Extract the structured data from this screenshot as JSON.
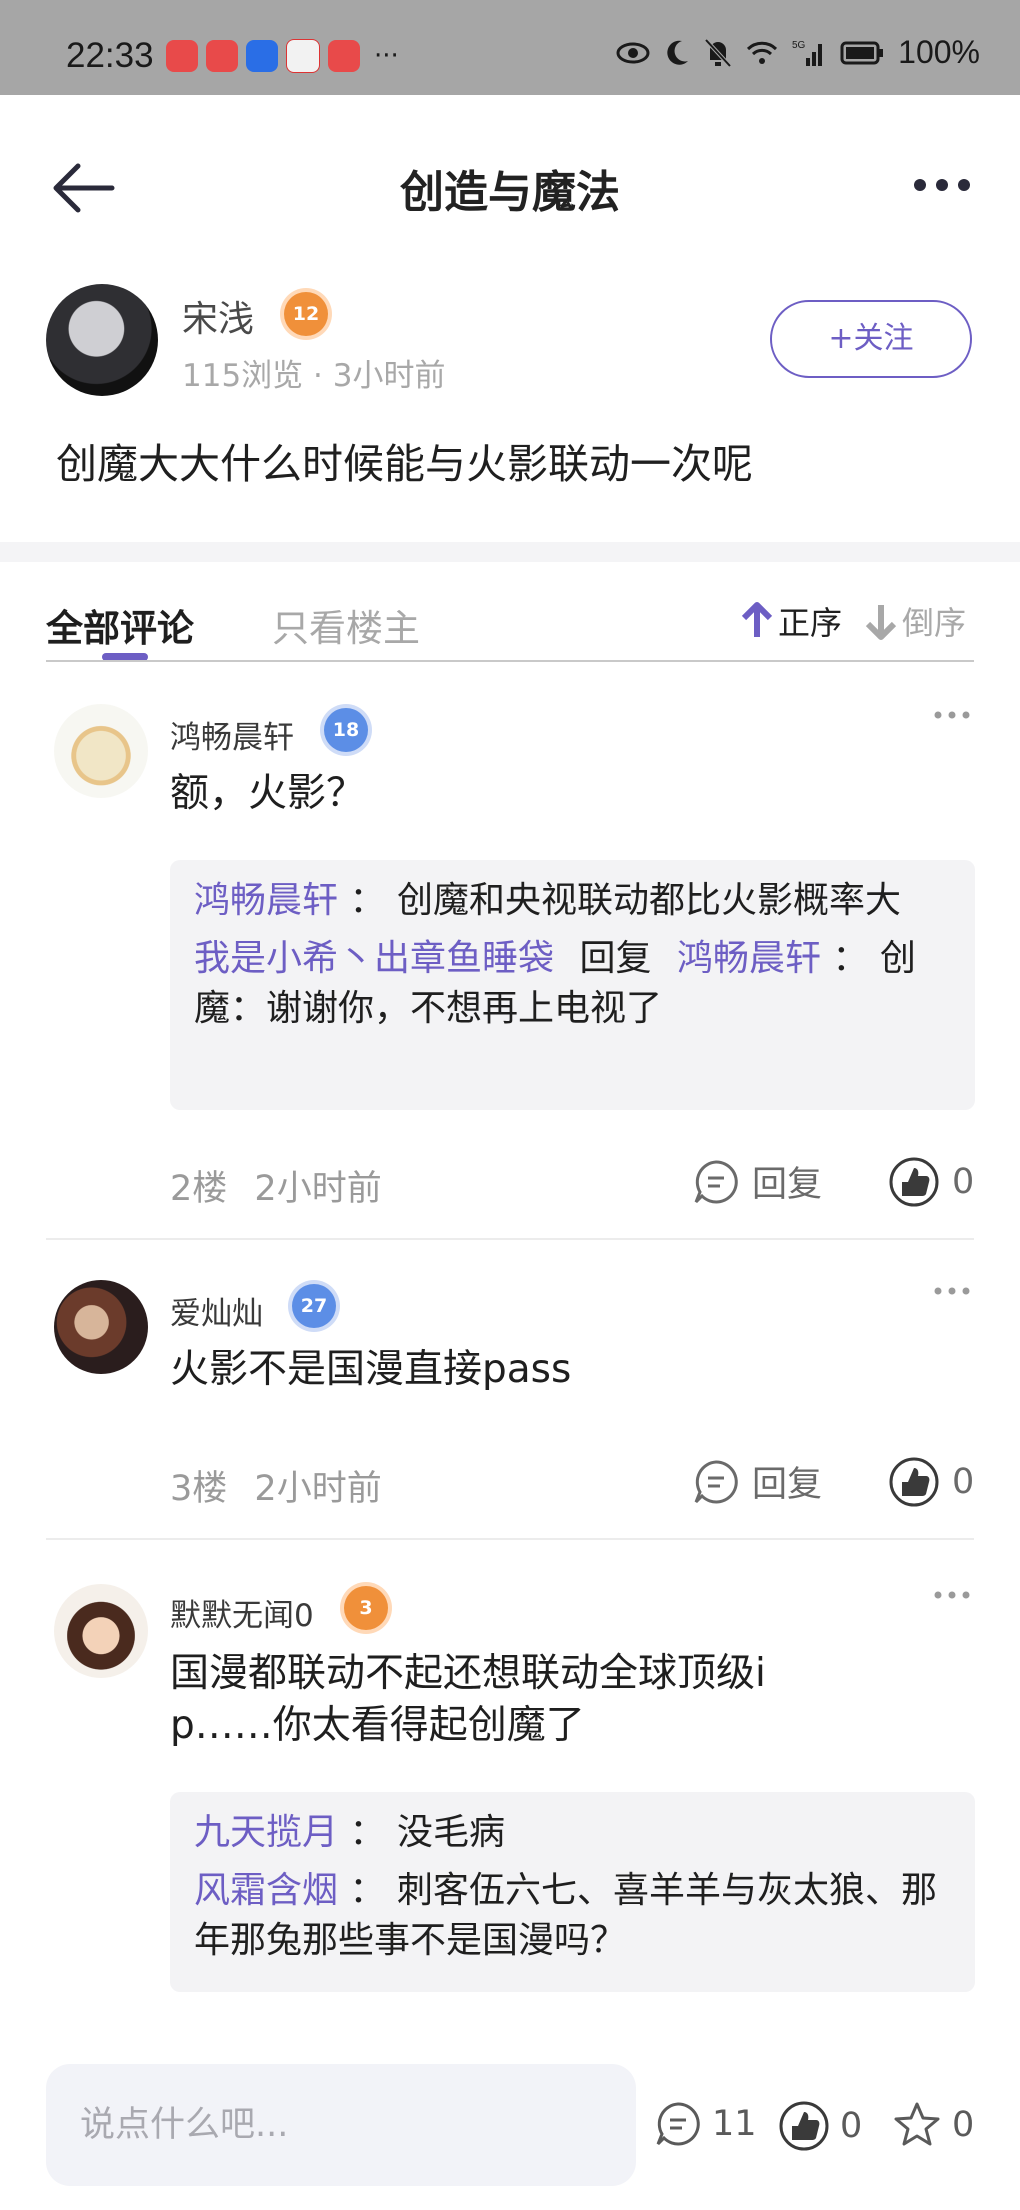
{
  "status_bar": {
    "time": "22:33",
    "battery": "100%"
  },
  "header": {
    "title": "创造与魔法"
  },
  "post": {
    "author": "宋浅",
    "author_level": "12",
    "views": "115浏览",
    "time": "3小时前",
    "follow_label": "+关注",
    "content": "创魔大大什么时候能与火影联动一次呢"
  },
  "tabs": {
    "all": "全部评论",
    "op_only": "只看楼主",
    "sort_asc": "正序",
    "sort_desc": "倒序"
  },
  "comments": [
    {
      "user": "鸿畅晨轩",
      "level": "18",
      "text": "额，火影？",
      "replies": [
        {
          "user": "鸿畅晨轩",
          "sep": "：",
          "text": "创魔和央视联动都比火影概率大"
        },
        {
          "user": "我是小希丶出章鱼睡袋",
          "reply_word": "回复",
          "reply_to": "鸿畅晨轩",
          "sep": "：",
          "text": "创魔：谢谢你，不想再上电视了"
        }
      ],
      "floor": "2楼",
      "time": "2小时前",
      "reply_label": "回复",
      "likes": "0"
    },
    {
      "user": "爱灿灿",
      "level": "27",
      "text": "火影不是国漫直接pass",
      "floor": "3楼",
      "time": "2小时前",
      "reply_label": "回复",
      "likes": "0"
    },
    {
      "user": "默默无闻0",
      "level": "3",
      "text_line1": "国漫都联动不起还想联动全球顶级i",
      "text_line2": "p……你太看得起创魔了",
      "replies": [
        {
          "user": "九天揽月",
          "sep": "：",
          "text": "没毛病"
        },
        {
          "user": "风霜含烟",
          "sep": "：",
          "text": "刺客伍六七、喜羊羊与灰太狼、那年那兔那些事不是国漫吗？"
        }
      ]
    }
  ],
  "bottom_bar": {
    "input_placeholder": "说点什么吧...",
    "comment_count": "11",
    "like_count": "0",
    "favorite_count": "0"
  },
  "colors": {
    "accent": "#6d5ec4",
    "muted": "#a8a8a8",
    "reply_bg": "#f3f3f5"
  }
}
